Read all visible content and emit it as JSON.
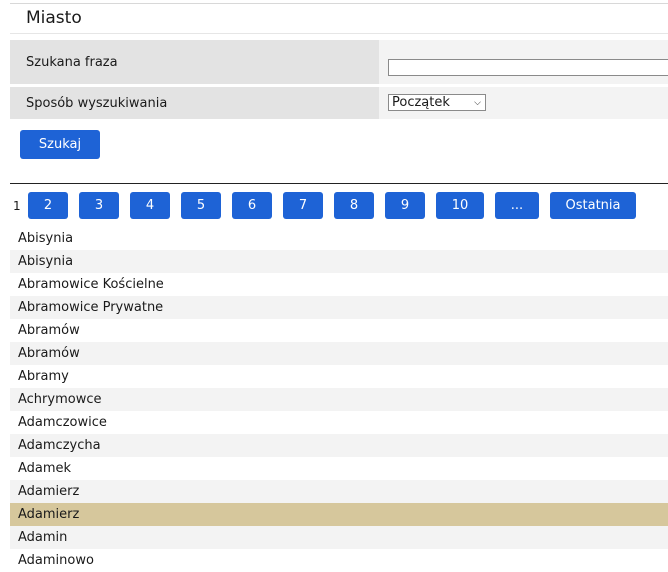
{
  "header": {
    "title": "Miasto"
  },
  "form": {
    "phrase_label": "Szukana fraza",
    "phrase_value": "",
    "mode_label": "Sposób wyszukiwania",
    "mode_selected": "Początek",
    "submit_label": "Szukaj"
  },
  "pager": {
    "current": "1",
    "pages": [
      "2",
      "3",
      "4",
      "5",
      "6",
      "7",
      "8",
      "9",
      "10"
    ],
    "more": "...",
    "last": "Ostatnia"
  },
  "results": [
    "Abisynia",
    "Abisynia",
    "Abramowice Kościelne",
    "Abramowice Prywatne",
    "Abramów",
    "Abramów",
    "Abramy",
    "Achrymowce",
    "Adamczowice",
    "Adamczycha",
    "Adamek",
    "Adamierz",
    "Adamierz",
    "Adamin",
    "Adaminowo"
  ],
  "selected_result_index": 12,
  "colors": {
    "button": "#1e63d6",
    "selected_row": "#d6c79c",
    "label_bg": "#e3e3e3"
  }
}
